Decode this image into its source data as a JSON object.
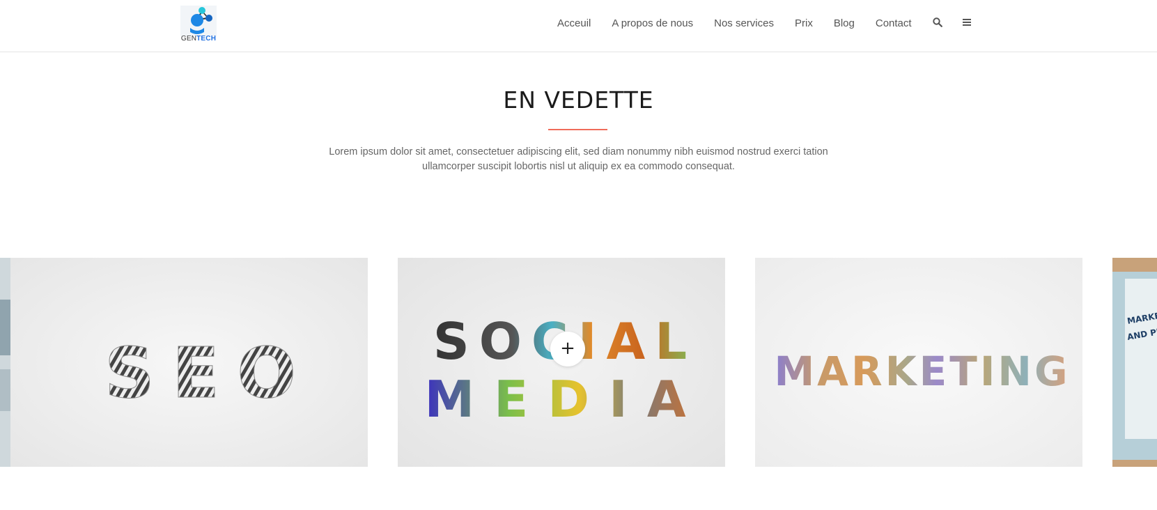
{
  "brand": {
    "logo_gen": "GEN",
    "logo_tech": "TECH"
  },
  "nav": {
    "items": [
      {
        "label": "Acceuil"
      },
      {
        "label": "A propos de nous"
      },
      {
        "label": "Nos services"
      },
      {
        "label": "Prix"
      },
      {
        "label": "Blog"
      },
      {
        "label": "Contact"
      }
    ],
    "icons": [
      "search-icon",
      "menu-icon"
    ]
  },
  "featured": {
    "title": "EN VEDETTE",
    "description_line1": "Lorem ipsum dolor sit amet, consectetuer adipiscing elit, sed diam nonummy nibh euismod nostrud exerci tation",
    "description_line2": "ullamcorper suscipit lobortis nisl ut aliquip ex ea commodo consequat."
  },
  "carousel": {
    "cards": [
      {
        "word": "SEO"
      },
      {
        "word_line1": "SOCIAL",
        "word_line2": "MEDIA"
      },
      {
        "word": "MARKETING"
      },
      {
        "partial_text_line1": "MARKETING",
        "partial_text_line2": "AND PRICING"
      }
    ],
    "plus_label": "+",
    "accent_color": "#f06b5a"
  }
}
